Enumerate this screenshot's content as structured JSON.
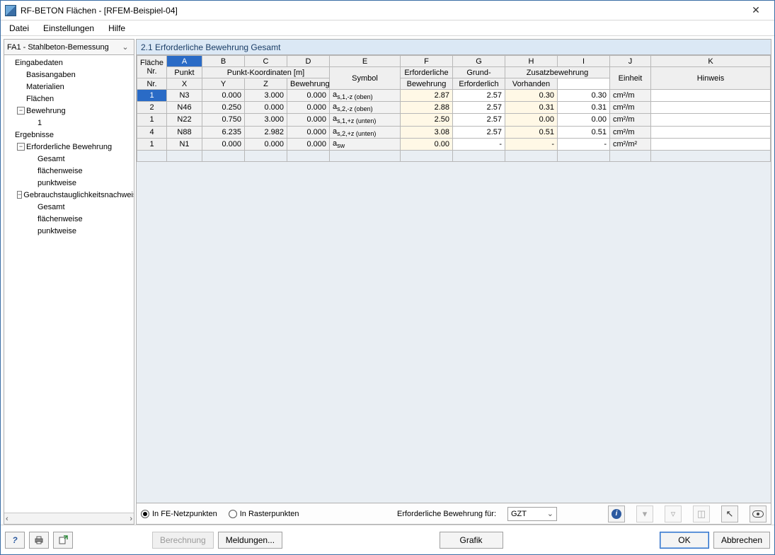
{
  "window": {
    "title": "RF-BETON Flächen - [RFEM-Beispiel-04]"
  },
  "menu": {
    "file": "Datei",
    "settings": "Einstellungen",
    "help": "Hilfe"
  },
  "case_selector": {
    "label": "FA1 - Stahlbeton-Bemessung"
  },
  "tree": {
    "n_eingabe": "Eingabedaten",
    "n_basis": "Basisangaben",
    "n_material": "Materialien",
    "n_flaechen": "Flächen",
    "n_bewehrung": "Bewehrung",
    "n_bew_1": "1",
    "n_ergebnisse": "Ergebnisse",
    "n_erf": "Erforderliche Bewehrung",
    "n_erf_gesamt": "Gesamt",
    "n_erf_flaechen": "flächenweise",
    "n_erf_punkt": "punktweise",
    "n_gzn": "Gebrauchstauglichkeitsnachweis",
    "n_gzn_gesamt": "Gesamt",
    "n_gzn_flaechen": "flächenweise",
    "n_gzn_punkt": "punktweise"
  },
  "panel": {
    "title": "2.1 Erforderliche Bewehrung Gesamt"
  },
  "cols": {
    "A": "A",
    "B": "B",
    "C": "C",
    "D": "D",
    "E": "E",
    "F": "F",
    "G": "G",
    "H": "H",
    "I": "I",
    "J": "J",
    "K": "K",
    "flaeche": "Fläche",
    "flaeche_nr": "Nr.",
    "punkt": "Punkt",
    "punkt_nr": "Nr.",
    "koord": "Punkt-Koordinaten [m]",
    "x": "X",
    "y": "Y",
    "z": "Z",
    "symbol": "Symbol",
    "erf": "Erforderliche",
    "erf2": "Bewehrung",
    "grund": "Grund-",
    "grund2": "Bewehrung",
    "zusatz": "Zusatzbewehrung",
    "zus_erf": "Erforderlich",
    "zus_vor": "Vorhanden",
    "einheit": "Einheit",
    "hinweis": "Hinweis"
  },
  "rows": [
    {
      "f": "1",
      "p": "N3",
      "x": "0.000",
      "y": "3.000",
      "z": "0.000",
      "sym": "a",
      "sub": "s,1,-z (oben)",
      "erf": "2.87",
      "grund": "2.57",
      "ze": "0.30",
      "zv": "0.30",
      "unit": "cm²/m"
    },
    {
      "f": "2",
      "p": "N46",
      "x": "0.250",
      "y": "0.000",
      "z": "0.000",
      "sym": "a",
      "sub": "s,2,-z (oben)",
      "erf": "2.88",
      "grund": "2.57",
      "ze": "0.31",
      "zv": "0.31",
      "unit": "cm²/m"
    },
    {
      "f": "1",
      "p": "N22",
      "x": "0.750",
      "y": "3.000",
      "z": "0.000",
      "sym": "a",
      "sub": "s,1,+z (unten)",
      "erf": "2.50",
      "grund": "2.57",
      "ze": "0.00",
      "zv": "0.00",
      "unit": "cm²/m"
    },
    {
      "f": "4",
      "p": "N88",
      "x": "6.235",
      "y": "2.982",
      "z": "0.000",
      "sym": "a",
      "sub": "s,2,+z (unten)",
      "erf": "3.08",
      "grund": "2.57",
      "ze": "0.51",
      "zv": "0.51",
      "unit": "cm²/m"
    },
    {
      "f": "1",
      "p": "N1",
      "x": "0.000",
      "y": "0.000",
      "z": "0.000",
      "sym": "a",
      "sub": "sw",
      "erf": "0.00",
      "grund": "-",
      "ze": "-",
      "zv": "-",
      "unit": "cm²/m²"
    }
  ],
  "options": {
    "radio_fe": "In FE-Netzpunkten",
    "radio_raster": "In Rasterpunkten",
    "erf_label": "Erforderliche Bewehrung für:",
    "dd_value": "GZT"
  },
  "footer": {
    "berechnung": "Berechnung",
    "meldungen": "Meldungen...",
    "grafik": "Grafik",
    "ok": "OK",
    "abbrechen": "Abbrechen"
  }
}
